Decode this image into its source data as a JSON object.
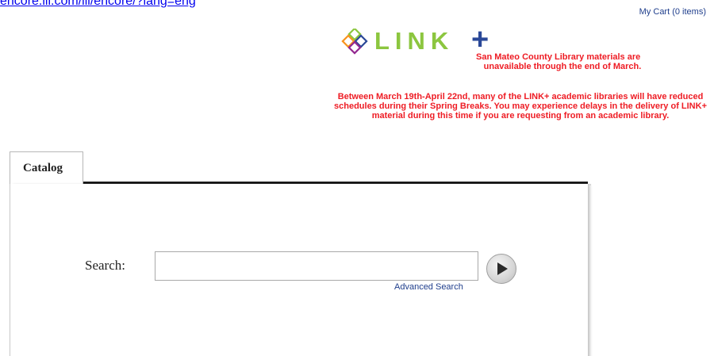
{
  "header": {
    "url_text": "encore.iii.com/iii/encore/?lang=eng",
    "cart_label": "My Cart (0 items)"
  },
  "logo": {
    "text": "LINK",
    "plus": "+"
  },
  "notices": {
    "notice1_line1": "San Mateo County Library materials are",
    "notice1_line2": "unavailable through the end of March.",
    "notice2": "Between March 19th-April 22nd, many of the LINK+ academic libraries will have reduced schedules during their Spring Breaks. You may experience delays in the delivery of LINK+ material during this time if you are requesting from an academic library."
  },
  "tabs": [
    {
      "label": "Catalog"
    }
  ],
  "search": {
    "label": "Search:",
    "value": "",
    "placeholder": "",
    "advanced_label": "Advanced Search"
  },
  "colors": {
    "notice_red": "#ee1c24",
    "link_blue": "#1f3e8c",
    "logo_green": "#8cc63f",
    "logo_blue": "#2a4898"
  },
  "icons": {
    "logo_mark": "link-plus-flower-icon",
    "search_go": "play-arrow-icon"
  }
}
